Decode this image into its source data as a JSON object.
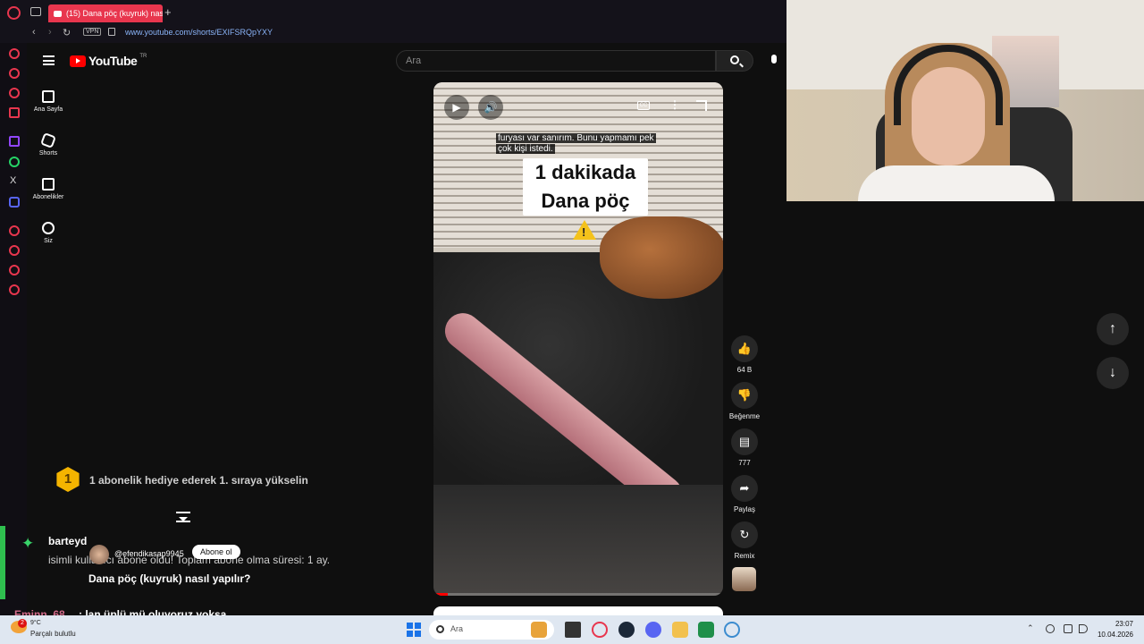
{
  "browser": {
    "tab_title": "(15) Dana pöç (kuyruk) nas",
    "new_tab": "+",
    "vpn_label": "VPN",
    "url": "www.youtube.com/shorts/EXIFSRQpYXY"
  },
  "youtube": {
    "logo_text": "YouTube",
    "logo_region": "TR",
    "search_placeholder": "Ara",
    "nav": [
      {
        "label": "Ana Sayfa",
        "icon": "home-icon"
      },
      {
        "label": "Shorts",
        "icon": "shorts-icon"
      },
      {
        "label": "Abonelikler",
        "icon": "subscriptions-icon"
      },
      {
        "label": "Siz",
        "icon": "you-icon"
      }
    ],
    "video": {
      "caption_line1": "furyası var sanırım. Bunu yapmamı pek",
      "caption_line2": "çok kişi istedi.",
      "title_card_line1": "1 dakikada",
      "title_card_line2": "Dana pöç",
      "warning_symbol": "!",
      "cc_label": "CC",
      "progress_fraction": 0.05
    },
    "actions": {
      "likes": "64 B",
      "dislike_label": "Beğenme",
      "comments": "777",
      "share_label": "Paylaş",
      "remix_label": "Remix"
    },
    "creator_handle": "@efendikasap9945",
    "subscribe_label": "Abone ol",
    "short_title": "Dana pöç (kuyruk) nasıl yapılır?"
  },
  "chat": {
    "gift_rank": "1",
    "gift_prompt": "1 abonelik hediye ederek 1. sıraya yükselin",
    "sub_user": "barteyd",
    "sub_message": "isimli kullanıcı abone oldu! Toplam abone olma süresi: 1 ay.",
    "line2_user": "Eminn_68",
    "line2_message": ": lan üplü mü oluyoruz yoksa"
  },
  "taskbar": {
    "weather_temp": "9°C",
    "weather_desc": "Parçalı bulutlu",
    "weather_badge": "2",
    "search_placeholder": "Ara",
    "time": "23:07",
    "date": "10.04.2026"
  },
  "colors": {
    "opera_accent": "#e8364e",
    "youtube_red": "#ff0000",
    "twitch_sub_green": "#2fbf4f"
  }
}
